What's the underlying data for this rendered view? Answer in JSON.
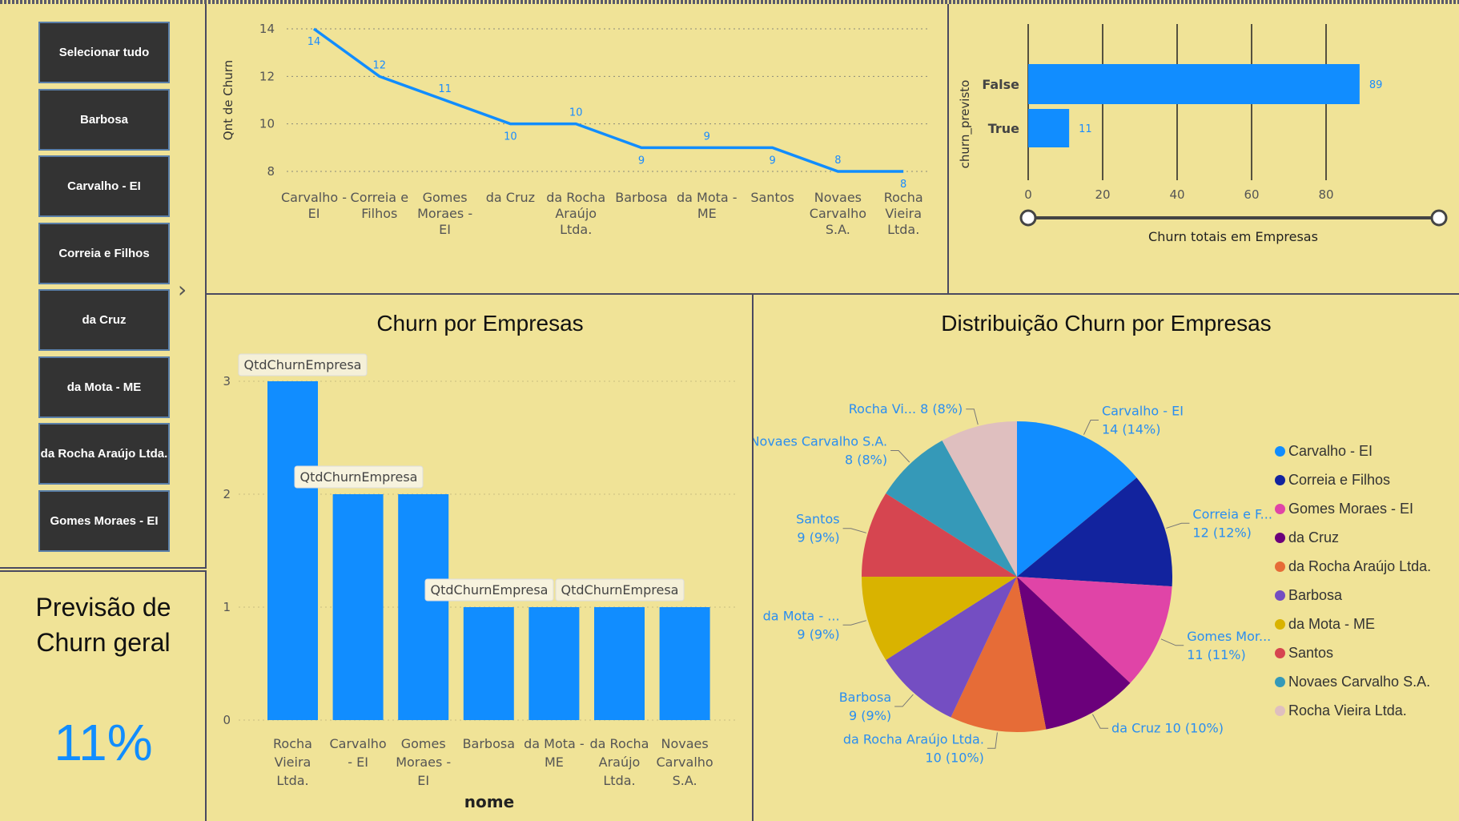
{
  "slicer": {
    "items": [
      "Selecionar tudo",
      "Barbosa",
      "Carvalho - EI",
      "Correia e Filhos",
      "da Cruz",
      "da Mota - ME",
      "da Rocha Araújo Ltda.",
      "Gomes Moraes - EI"
    ],
    "more_icon": "chevron-right-icon"
  },
  "kpi": {
    "title": "Previsão de Churn geral",
    "value": "11%"
  },
  "colors": {
    "accent": "#118dff",
    "background": "#f0e397",
    "slicer_button": "#333333"
  },
  "chart_data": [
    {
      "id": "line",
      "type": "line",
      "title": "",
      "ylabel": "Qnt de Churn",
      "xlabel": "",
      "ylim": [
        8,
        14
      ],
      "yticks": [
        8,
        10,
        12,
        14
      ],
      "categories": [
        "Carvalho - EI",
        "Correia e Filhos",
        "Gomes Moraes - EI",
        "da Cruz",
        "da Rocha Araújo Ltda.",
        "Barbosa",
        "da Mota - ME",
        "Santos",
        "Novaes Carvalho S.A.",
        "Rocha Vieira Ltda."
      ],
      "values": [
        14,
        12,
        11,
        10,
        10,
        9,
        9,
        9,
        8,
        8
      ],
      "grid": true
    },
    {
      "id": "hbar",
      "type": "bar",
      "orientation": "horizontal",
      "title": "",
      "ylabel": "churn_previsto",
      "xlabel": "Churn totais em Empresas",
      "categories": [
        "False",
        "True"
      ],
      "values": [
        89,
        11
      ],
      "xticks": [
        0,
        20,
        40,
        60,
        80
      ],
      "xlim": [
        0,
        95
      ],
      "range_slider": true
    },
    {
      "id": "bar",
      "type": "bar",
      "title": "Churn por Empresas",
      "xlabel": "nome",
      "ylabel": "",
      "ylim": [
        0,
        3
      ],
      "yticks": [
        0,
        1,
        2,
        3
      ],
      "categories": [
        "Rocha Vieira Ltda.",
        "Carvalho - EI",
        "Gomes Moraes - EI",
        "Barbosa",
        "da Mota - ME",
        "da Rocha Araújo Ltda.",
        "Novaes Carvalho S.A."
      ],
      "values": [
        3,
        2,
        2,
        1,
        1,
        1,
        1
      ],
      "tooltips": [
        "QtdChurnEmpresa",
        "QtdChurnEmpresa",
        "QtdChurnEmpresa",
        "QtdChurnEmpresa"
      ]
    },
    {
      "id": "pie",
      "type": "pie",
      "title": "Distribuição Churn por Empresas",
      "slices": [
        {
          "name": "Carvalho - EI",
          "value": 14,
          "label": [
            "Carvalho - EI",
            "14 (14%)"
          ],
          "color": "#118dff"
        },
        {
          "name": "Correia e Filhos",
          "value": 12,
          "label": [
            "Correia e F...",
            "12 (12%)"
          ],
          "color": "#12239e"
        },
        {
          "name": "Gomes Moraes - EI",
          "value": 11,
          "label": [
            "Gomes Mor...",
            "11 (11%)"
          ],
          "color": "#e044a7"
        },
        {
          "name": "da Cruz",
          "value": 10,
          "label": [
            "da Cruz 10 (10%)"
          ],
          "color": "#6b007b"
        },
        {
          "name": "da Rocha Araújo Ltda.",
          "value": 10,
          "label": [
            "da Rocha Araújo Ltda.",
            "10 (10%)"
          ],
          "color": "#e66c37"
        },
        {
          "name": "Barbosa",
          "value": 9,
          "label": [
            "Barbosa",
            "9 (9%)"
          ],
          "color": "#744ec2"
        },
        {
          "name": "da Mota - ME",
          "value": 9,
          "label": [
            "da Mota - ...",
            "9 (9%)"
          ],
          "color": "#d9b300"
        },
        {
          "name": "Santos",
          "value": 9,
          "label": [
            "Santos",
            "9 (9%)"
          ],
          "color": "#d64550"
        },
        {
          "name": "Novaes Carvalho S.A.",
          "value": 8,
          "label": [
            "Novaes Carvalho S.A.",
            "8 (8%)"
          ],
          "color": "#3599b8"
        },
        {
          "name": "Rocha Vieira Ltda.",
          "value": 8,
          "label": [
            "Rocha Vi... 8 (8%)"
          ],
          "color": "#dfbfbf"
        }
      ],
      "legend": [
        "Carvalho - EI",
        "Correia e Filhos",
        "Gomes Moraes - EI",
        "da Cruz",
        "da Rocha Araújo Ltda.",
        "Barbosa",
        "da Mota - ME",
        "Santos",
        "Novaes Carvalho S.A.",
        "Rocha Vieira Ltda."
      ],
      "legend_position": "right"
    }
  ]
}
